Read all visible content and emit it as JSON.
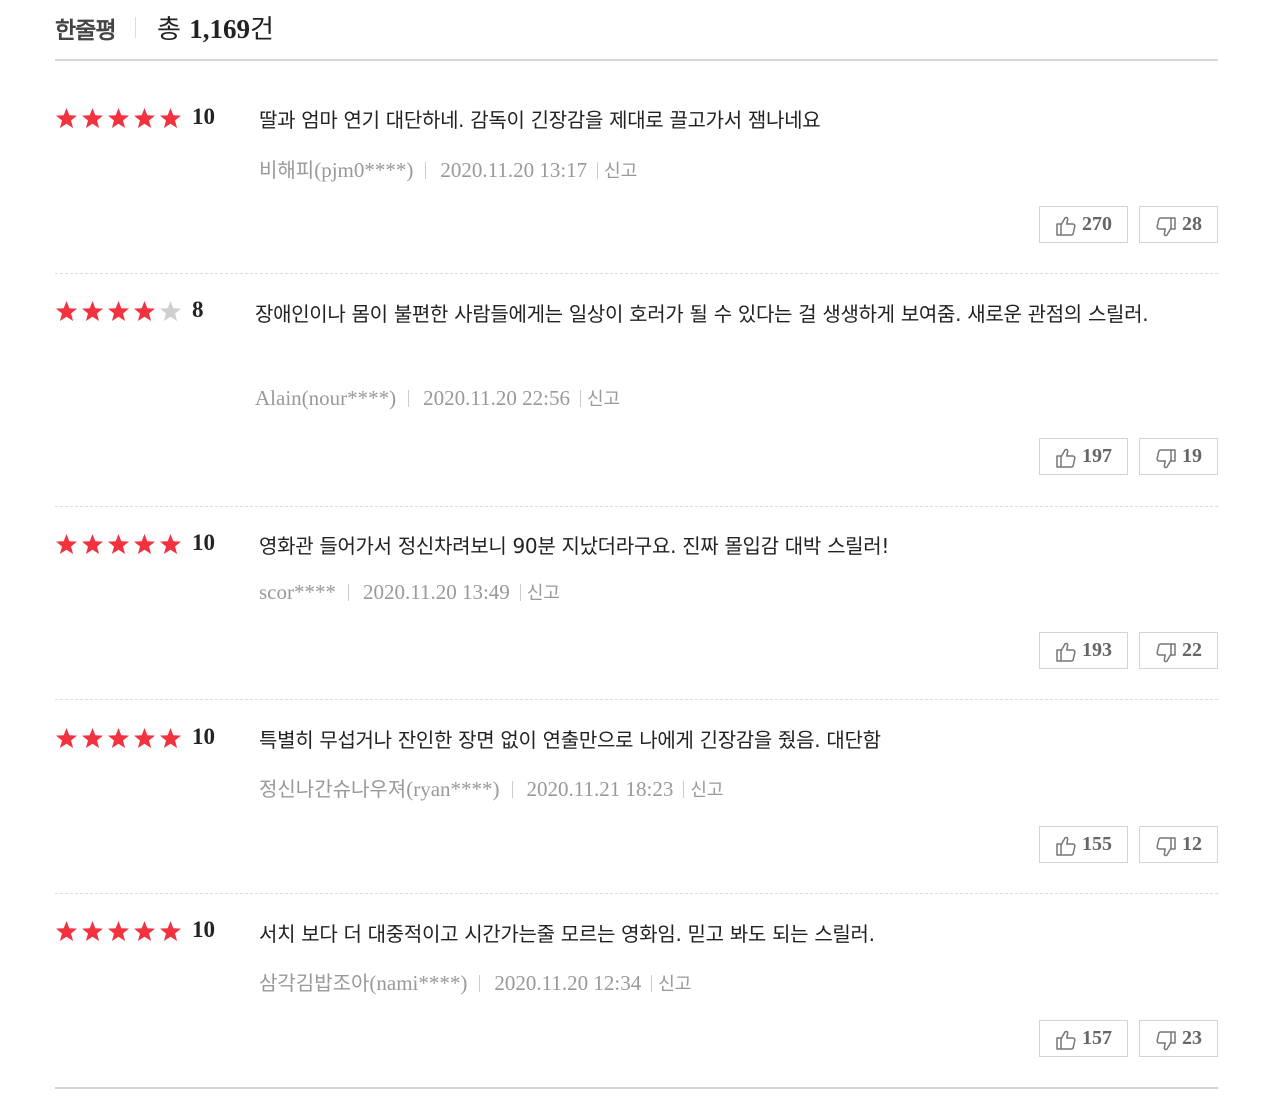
{
  "header": {
    "title": "한줄평",
    "total_label": "총",
    "total_count": "1,169",
    "total_unit": "건"
  },
  "colors": {
    "star_on": "#f2323f",
    "star_off": "#cfcfcf"
  },
  "reviews": [
    {
      "rating": 10,
      "stars_filled": 5,
      "score_text": "10",
      "content": "딸과 엄마 연기 대단하네. 감독이 긴장감을 제대로 끌고가서 잼나네요",
      "author_name": "비해피",
      "author_id": "(pjm0****)",
      "date": "2020.11.20 13:17",
      "report_label": "신고",
      "likes": "270",
      "dislikes": "28"
    },
    {
      "rating": 8,
      "stars_filled": 4,
      "score_text": "8",
      "content": "장애인이나 몸이 불편한 사람들에게는 일상이 호러가 될 수 있다는 걸 생생하게 보여줌. 새로운 관점의 스릴러.",
      "author_name": "",
      "author_id": "Alain(nour****)",
      "date": "2020.11.20 22:56",
      "report_label": "신고",
      "likes": "197",
      "dislikes": "19"
    },
    {
      "rating": 10,
      "stars_filled": 5,
      "score_text": "10",
      "content": "영화관 들어가서 정신차려보니 90분 지났더라구요. 진짜 몰입감 대박 스릴러!",
      "author_name": "",
      "author_id": "scor****",
      "date": "2020.11.20 13:49",
      "report_label": "신고",
      "likes": "193",
      "dislikes": "22"
    },
    {
      "rating": 10,
      "stars_filled": 5,
      "score_text": "10",
      "content": "특별히 무섭거나 잔인한 장면 없이 연출만으로 나에게 긴장감을 줬음. 대단함",
      "author_name": "정신나간슈나우져",
      "author_id": "(ryan****)",
      "date": "2020.11.21 18:23",
      "report_label": "신고",
      "likes": "155",
      "dislikes": "12"
    },
    {
      "rating": 10,
      "stars_filled": 5,
      "score_text": "10",
      "content": "서치 보다 더 대중적이고 시간가는줄 모르는 영화임. 믿고 봐도 되는 스릴러.",
      "author_name": "삼각김밥조아",
      "author_id": "(nami****)",
      "date": "2020.11.20 12:34",
      "report_label": "신고",
      "likes": "157",
      "dislikes": "23"
    }
  ]
}
